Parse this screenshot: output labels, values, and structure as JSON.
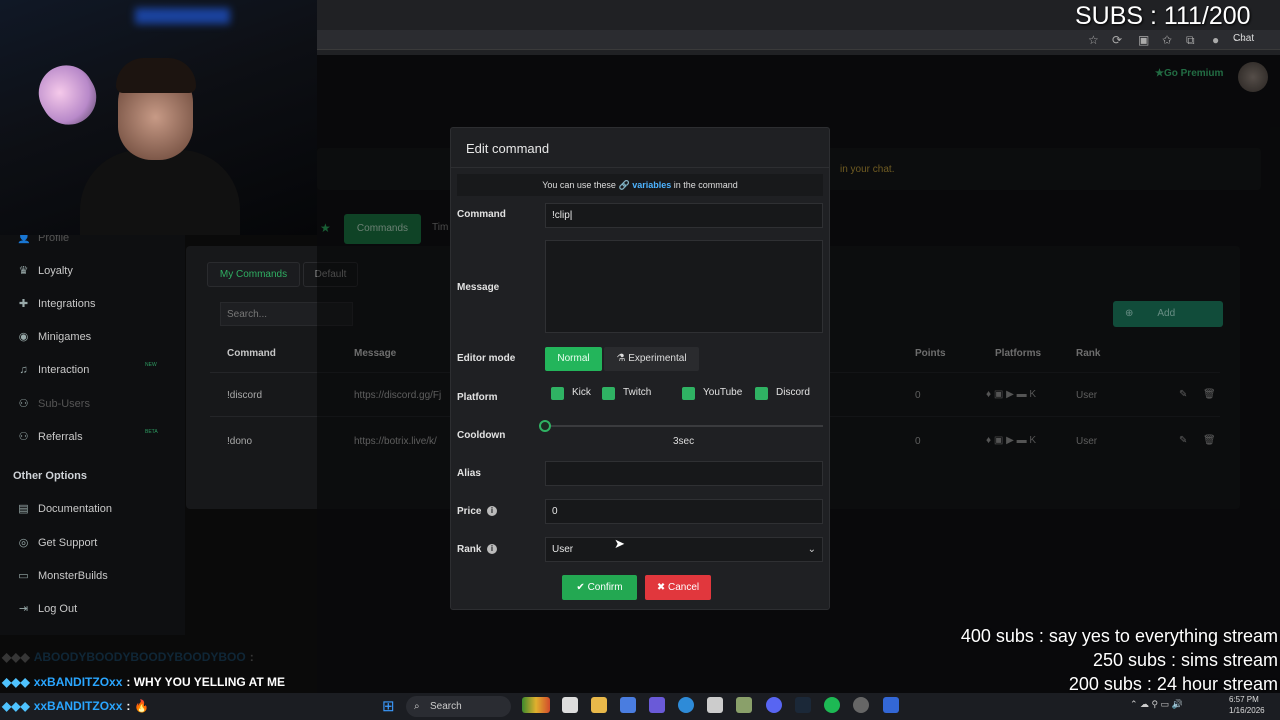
{
  "browser": {
    "chat_label": "Chat"
  },
  "stream": {
    "subs_counter": "SUBS : 111/200",
    "goals": [
      "400 subs :  say yes to everything stream",
      "250 subs : sims stream",
      "200 subs : 24 hour stream"
    ],
    "chat": [
      {
        "user": "ABOODYBOODYBOODYBOODYBOO",
        "message": ":"
      },
      {
        "user": "xxBANDITZOxx",
        "message": ": WHY YOU YELLING AT ME"
      },
      {
        "user": "xxBANDITZOxx",
        "message": ":"
      }
    ]
  },
  "header": {
    "premium_label": "Go Premium",
    "banner_text": "in your chat."
  },
  "tabs": {
    "commands": "Commands",
    "timers": "Tim"
  },
  "sidebar": {
    "items": [
      {
        "label": "Profile",
        "icon": "user-icon"
      },
      {
        "label": "Loyalty",
        "icon": "trophy-icon"
      },
      {
        "label": "Integrations",
        "icon": "puzzle-icon"
      },
      {
        "label": "Minigames",
        "icon": "gamepad-icon"
      },
      {
        "label": "Interaction",
        "icon": "music-icon",
        "tag": "NEW"
      },
      {
        "label": "Sub-Users",
        "icon": "users-icon"
      },
      {
        "label": "Referrals",
        "icon": "users-icon",
        "tag": "BETA"
      }
    ],
    "other_options_title": "Other Options",
    "other_items": [
      {
        "label": "Documentation",
        "icon": "doc-icon"
      },
      {
        "label": "Get Support",
        "icon": "support-icon"
      },
      {
        "label": "MonsterBuilds",
        "icon": "monitor-icon"
      },
      {
        "label": "Log Out",
        "icon": "logout-icon"
      }
    ]
  },
  "commands_panel": {
    "subtabs": {
      "my_commands": "My Commands",
      "default": "Default"
    },
    "search_placeholder": "Search...",
    "add_label": "Add",
    "columns": {
      "command": "Command",
      "message": "Message",
      "points": "Points",
      "platforms": "Platforms",
      "rank": "Rank"
    },
    "rows": [
      {
        "command": "!discord",
        "message": "https://discord.gg/Fj",
        "points": "0",
        "rank": "User"
      },
      {
        "command": "!dono",
        "message": "https://botrix.live/k/",
        "points": "0",
        "rank": "User"
      }
    ]
  },
  "modal": {
    "title": "Edit command",
    "variables_note_prefix": "You can use these",
    "variables_link": "variables",
    "variables_note_suffix": "in the command",
    "labels": {
      "command": "Command",
      "message": "Message",
      "editor_mode": "Editor mode",
      "platform": "Platform",
      "cooldown": "Cooldown",
      "alias": "Alias",
      "price": "Price",
      "rank": "Rank"
    },
    "command_value": "!clip",
    "message_value": "",
    "editor_modes": {
      "normal": "Normal",
      "experimental": "Experimental",
      "selected": "Normal"
    },
    "platforms": [
      "Kick",
      "Twitch",
      "YouTube",
      "Discord"
    ],
    "cooldown_value": "3sec",
    "cooldown_fraction": 0,
    "alias_value": "",
    "price_value": "0",
    "rank_value": "User",
    "confirm_label": "Confirm",
    "cancel_label": "Cancel"
  },
  "taskbar": {
    "search_label": "Search",
    "time": "6:57 PM",
    "date": "1/16/2026"
  }
}
